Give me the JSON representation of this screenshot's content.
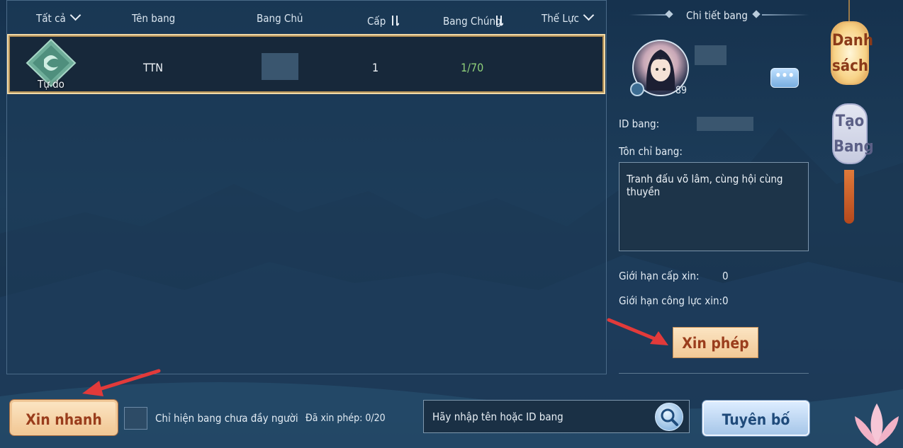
{
  "header": {
    "columns": [
      {
        "label": "Tất cả",
        "icon": "chevron-down-icon"
      },
      {
        "label": "Tên bang"
      },
      {
        "label": "Bang Chủ"
      },
      {
        "label": "Cấp",
        "icon": "sort-icon"
      },
      {
        "label": "Bang Chúng",
        "icon": "sort-icon"
      },
      {
        "label": "Thế Lực",
        "icon": "chevron-down-icon"
      }
    ]
  },
  "guild_rows": [
    {
      "type_label": "Tự do",
      "name": "TTN",
      "leader": "",
      "level": "1",
      "members": "1/70",
      "faction": ""
    }
  ],
  "details": {
    "title": "Chi tiết bang",
    "avatar_level": "89",
    "id_label": "ID bang:",
    "motto_label": "Tôn chỉ bang:",
    "motto": "Tranh đấu võ lâm, cùng hội cùng thuyền",
    "level_limit_label": "Giới hạn cấp xin:",
    "level_limit_value": "0",
    "power_limit_label": "Giới hạn công lực xin:",
    "power_limit_value": "0",
    "apply_label": "Xin phép"
  },
  "bottom": {
    "quick_label": "Xin nhanh",
    "filter_label": "Chỉ hiện bang chưa đầy người",
    "applied_label": "Đã xin phép: 0/20",
    "search_placeholder": "Hãy nhập tên hoặc ID bang",
    "declare_label": "Tuyên bố"
  },
  "side_tabs": {
    "list_label_1": "Danh",
    "list_label_2": "sách",
    "create_label_1": "Tạo",
    "create_label_2": "Bang"
  },
  "colors": {
    "accent_gold": "#f1d9a6",
    "members_green": "#8fd07a",
    "apply_text": "#9a3d1c"
  }
}
